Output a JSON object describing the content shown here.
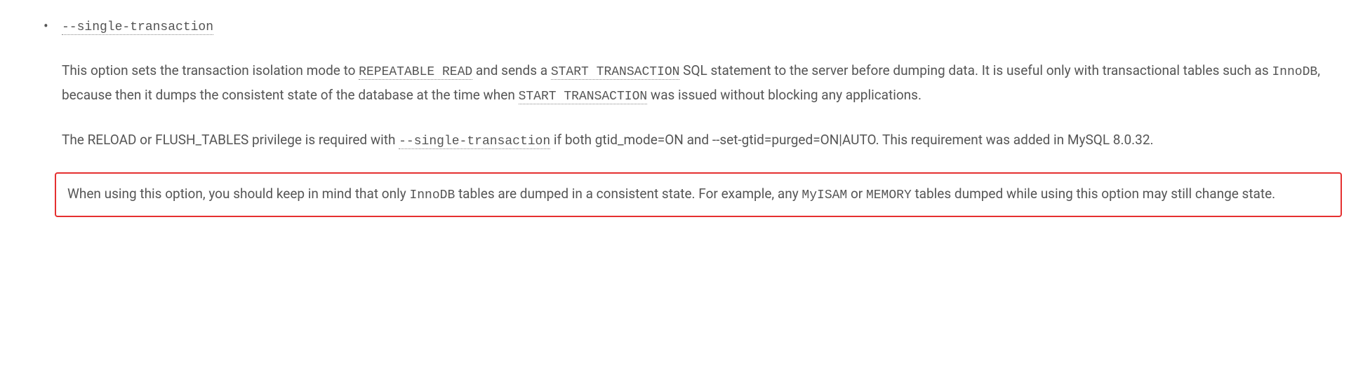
{
  "option": {
    "name": "--single-transaction",
    "para1": {
      "t1": "This option sets the transaction isolation mode to ",
      "code1": "REPEATABLE READ",
      "t2": " and sends a ",
      "code2": "START TRANSACTION",
      "t3": " SQL statement to the server before dumping data. It is useful only with transactional tables such as ",
      "code3": "InnoDB",
      "t4": ", because then it dumps the consistent state of the database at the time when ",
      "code4": "START TRANSACTION",
      "t5": " was issued without blocking any applications."
    },
    "para2": {
      "t1": "The RELOAD or FLUSH_TABLES privilege is required with ",
      "code1": "--single-transaction",
      "t2": " if both gtid_mode=ON and --set-gtid=purged=ON|AUTO. This requirement was added in MySQL 8.0.32."
    },
    "note": {
      "t1": "When using this option, you should keep in mind that only ",
      "code1": "InnoDB",
      "t2": " tables are dumped in a consistent state. For example, any ",
      "code2": "MyISAM",
      "t3": " or ",
      "code3": "MEMORY",
      "t4": " tables dumped while using this option may still change state."
    }
  }
}
